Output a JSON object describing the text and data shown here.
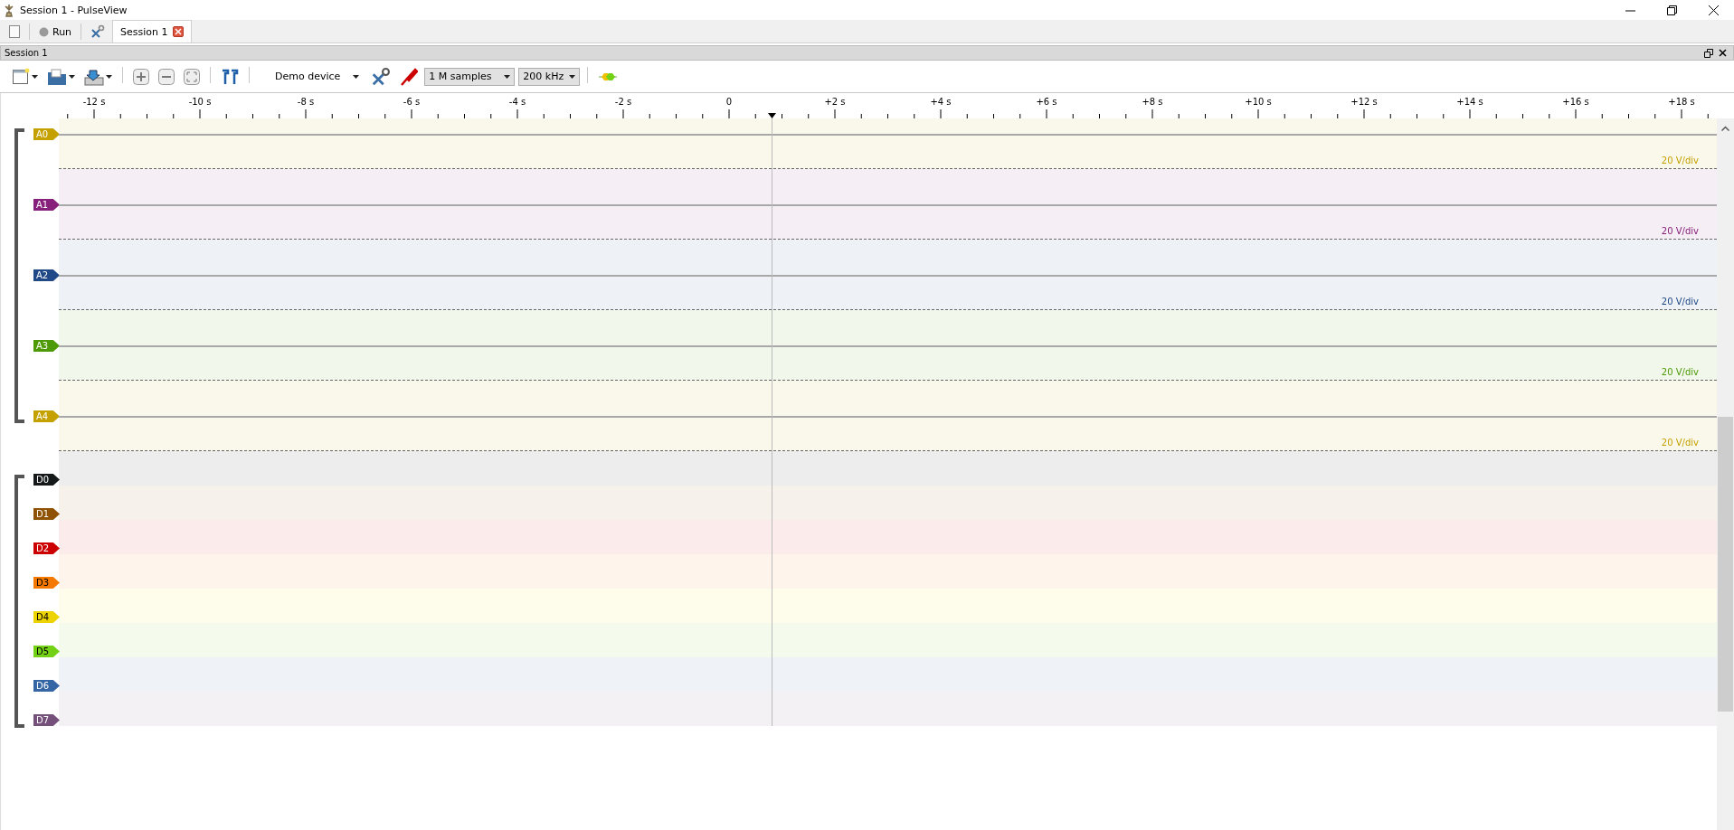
{
  "window": {
    "title": "Session 1 - PulseView"
  },
  "main_toolbar": {
    "run_label": "Run"
  },
  "tabs": [
    {
      "label": "Session 1",
      "selected": true
    }
  ],
  "session": {
    "title": "Session 1"
  },
  "toolbar": {
    "device": "Demo device",
    "sample_count": "1 M samples",
    "sample_rate": "200 kHz"
  },
  "ruler": {
    "ticks": [
      "-12 s",
      "-10 s",
      "-8 s",
      "-6 s",
      "-4 s",
      "-2 s",
      "0",
      "+2 s",
      "+4 s",
      "+6 s",
      "+8 s",
      "+10 s",
      "+12 s",
      "+14 s",
      "+16 s",
      "+18 s"
    ]
  },
  "analog_channels": [
    {
      "name": "A0",
      "color": "#c4a000",
      "scale": "20 V/div"
    },
    {
      "name": "A1",
      "color": "#87207a",
      "scale": "20 V/div"
    },
    {
      "name": "A2",
      "color": "#204a87",
      "scale": "20 V/div"
    },
    {
      "name": "A3",
      "color": "#4e9a06",
      "scale": "20 V/div"
    },
    {
      "name": "A4",
      "color": "#c4a000",
      "scale": "20 V/div"
    }
  ],
  "digital_channels": [
    {
      "name": "D0",
      "color": "#16191a"
    },
    {
      "name": "D1",
      "color": "#8f5202"
    },
    {
      "name": "D2",
      "color": "#cc0000"
    },
    {
      "name": "D3",
      "color": "#f57900"
    },
    {
      "name": "D4",
      "color": "#edd400"
    },
    {
      "name": "D5",
      "color": "#73d216"
    },
    {
      "name": "D6",
      "color": "#3465a4"
    },
    {
      "name": "D7",
      "color": "#75507b"
    }
  ]
}
